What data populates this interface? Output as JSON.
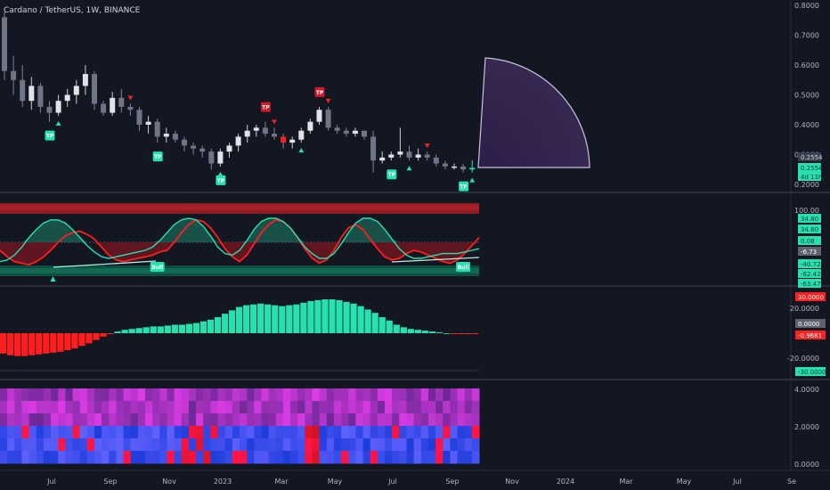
{
  "header": {
    "symbol": "Cardano / TetherUS, 1W, BINANCE"
  },
  "colors": {
    "background": "#131722",
    "bull": "#26e0b0",
    "bear": "#ff1e1e",
    "candle": "#b2b5be",
    "divider": "#2a2e39",
    "fan_fill": "#3a2a55",
    "fan_stroke": "#c8c3de"
  },
  "price_axis": {
    "ticks": [
      "0.8000",
      "0.7000",
      "0.6000",
      "0.5000",
      "0.4000",
      "0.3000",
      "0.2000"
    ],
    "tick_values": [
      0.8,
      0.7,
      0.6,
      0.5,
      0.4,
      0.3,
      0.2
    ],
    "badges": [
      {
        "text": "0.2554",
        "color": "#3a4150"
      },
      {
        "text": "0.2554",
        "color": "#26e0b0"
      },
      {
        "text": "4d 11h",
        "color": "#26e0b0"
      }
    ]
  },
  "osc_axis": {
    "ticks": [
      "100.00"
    ],
    "badges": [
      {
        "text": "34.80",
        "color": "#26e0b0"
      },
      {
        "text": "34.80",
        "color": "#26e0b0"
      },
      {
        "text": "0.08",
        "color": "#26e0b0"
      },
      {
        "text": "-6.73",
        "color": "#5d6270"
      },
      {
        "text": "-40.72",
        "color": "#26e0b0"
      },
      {
        "text": "-62.42",
        "color": "#26e0b0"
      },
      {
        "text": "-63.47",
        "color": "#26e0b0"
      }
    ]
  },
  "hist_axis": {
    "ticks": [
      "20.0000",
      "-20.0000"
    ],
    "badges": [
      {
        "text": "30.0000",
        "color": "#ff1e1e"
      },
      {
        "text": "0.0000",
        "color": "#5d6270"
      },
      {
        "text": "-0.9681",
        "color": "#ff1e1e"
      },
      {
        "text": "-30.0000",
        "color": "#26e0b0"
      }
    ]
  },
  "heat_axis": {
    "ticks": [
      "4.0000",
      "2.0000",
      "0.0000"
    ]
  },
  "time_axis": {
    "labels": [
      "Jul",
      "Sep",
      "Nov",
      "2023",
      "Mar",
      "May",
      "Jul",
      "Sep",
      "Nov",
      "2024",
      "Mar",
      "May",
      "Jul",
      "Se"
    ]
  },
  "markers": {
    "tp": "TP",
    "bull": "Bull",
    "tp_bull_bars": [
      5,
      17,
      24,
      43,
      51
    ],
    "tp_bear_bars": [
      29,
      35
    ],
    "arrow_up_bars": [
      6,
      24,
      33,
      45,
      52
    ],
    "arrow_down_bars": [
      14,
      30,
      36,
      47
    ],
    "bull_labels_bars": [
      17,
      51
    ],
    "osc_arrow_up_bars": [
      5
    ]
  },
  "chart_data": {
    "type": "candlestick",
    "title": "Cardano / TetherUS, 1W, BINANCE",
    "ylim": [
      0.2,
      0.8
    ],
    "candles": [
      [
        0.76,
        0.78,
        0.55,
        0.58
      ],
      [
        0.58,
        0.63,
        0.5,
        0.55
      ],
      [
        0.55,
        0.6,
        0.46,
        0.48
      ],
      [
        0.48,
        0.56,
        0.45,
        0.53
      ],
      [
        0.53,
        0.54,
        0.44,
        0.46
      ],
      [
        0.46,
        0.48,
        0.41,
        0.44
      ],
      [
        0.44,
        0.5,
        0.43,
        0.48
      ],
      [
        0.48,
        0.52,
        0.46,
        0.5
      ],
      [
        0.5,
        0.55,
        0.47,
        0.53
      ],
      [
        0.53,
        0.6,
        0.5,
        0.57
      ],
      [
        0.57,
        0.58,
        0.45,
        0.47
      ],
      [
        0.47,
        0.48,
        0.43,
        0.44
      ],
      [
        0.44,
        0.51,
        0.43,
        0.49
      ],
      [
        0.49,
        0.52,
        0.44,
        0.46
      ],
      [
        0.46,
        0.47,
        0.43,
        0.45
      ],
      [
        0.45,
        0.46,
        0.38,
        0.4
      ],
      [
        0.4,
        0.43,
        0.37,
        0.41
      ],
      [
        0.41,
        0.42,
        0.34,
        0.36
      ],
      [
        0.36,
        0.39,
        0.34,
        0.37
      ],
      [
        0.37,
        0.38,
        0.34,
        0.35
      ],
      [
        0.35,
        0.36,
        0.31,
        0.33
      ],
      [
        0.33,
        0.34,
        0.3,
        0.32
      ],
      [
        0.32,
        0.33,
        0.29,
        0.31
      ],
      [
        0.31,
        0.32,
        0.25,
        0.27
      ],
      [
        0.27,
        0.32,
        0.26,
        0.31
      ],
      [
        0.31,
        0.34,
        0.29,
        0.33
      ],
      [
        0.33,
        0.37,
        0.31,
        0.36
      ],
      [
        0.36,
        0.4,
        0.34,
        0.38
      ],
      [
        0.38,
        0.4,
        0.36,
        0.39
      ],
      [
        0.39,
        0.41,
        0.36,
        0.37
      ],
      [
        0.37,
        0.39,
        0.35,
        0.36
      ],
      [
        0.36,
        0.37,
        0.32,
        0.34
      ],
      [
        0.34,
        0.36,
        0.32,
        0.35
      ],
      [
        0.35,
        0.39,
        0.34,
        0.38
      ],
      [
        0.38,
        0.42,
        0.37,
        0.41
      ],
      [
        0.41,
        0.46,
        0.4,
        0.45
      ],
      [
        0.45,
        0.46,
        0.38,
        0.39
      ],
      [
        0.39,
        0.4,
        0.37,
        0.38
      ],
      [
        0.38,
        0.39,
        0.36,
        0.37
      ],
      [
        0.37,
        0.39,
        0.36,
        0.38
      ],
      [
        0.38,
        0.38,
        0.35,
        0.36
      ],
      [
        0.36,
        0.38,
        0.24,
        0.28
      ],
      [
        0.28,
        0.31,
        0.27,
        0.29
      ],
      [
        0.29,
        0.31,
        0.28,
        0.3
      ],
      [
        0.3,
        0.39,
        0.29,
        0.31
      ],
      [
        0.31,
        0.33,
        0.28,
        0.29
      ],
      [
        0.29,
        0.32,
        0.28,
        0.3
      ],
      [
        0.3,
        0.31,
        0.28,
        0.29
      ],
      [
        0.29,
        0.3,
        0.26,
        0.27
      ],
      [
        0.27,
        0.28,
        0.25,
        0.26
      ],
      [
        0.26,
        0.27,
        0.25,
        0.26
      ],
      [
        0.26,
        0.27,
        0.24,
        0.25
      ],
      [
        0.25,
        0.28,
        0.24,
        0.2554
      ]
    ],
    "histogram": [
      -24,
      -26,
      -27,
      -27,
      -26,
      -25,
      -24,
      -23,
      -22,
      -20,
      -18,
      -15,
      -12,
      -8,
      -4,
      -1,
      2,
      4,
      5,
      6,
      7,
      8,
      8,
      9,
      10,
      10,
      11,
      12,
      14,
      16,
      19,
      23,
      27,
      31,
      33,
      34,
      35,
      34,
      33,
      32,
      33,
      34,
      36,
      38,
      39,
      40,
      40,
      39,
      37,
      35,
      32,
      28,
      24,
      19,
      15,
      10,
      7,
      5,
      4,
      3,
      2,
      1,
      0,
      -1,
      -1,
      -1,
      -1
    ],
    "oscillator": {
      "red": [
        -10,
        -18,
        -24,
        -26,
        -28,
        -24,
        -18,
        -10,
        0,
        8,
        12,
        14,
        10,
        4,
        -6,
        -16,
        -22,
        -24,
        -22,
        -20,
        -18,
        -16,
        -12,
        -10,
        0,
        12,
        22,
        28,
        26,
        18,
        6,
        -8,
        -18,
        -24,
        -16,
        -2,
        12,
        22,
        28,
        26,
        18,
        6,
        -8,
        -20,
        -26,
        -22,
        -10,
        6,
        18,
        22,
        16,
        4,
        -8,
        -18,
        -22,
        -20,
        -14,
        -10,
        -12,
        -16,
        -20,
        -24,
        -26,
        -22,
        -14,
        -4,
        6
      ],
      "teal": [
        -24,
        -22,
        -16,
        -6,
        6,
        16,
        24,
        28,
        28,
        24,
        16,
        6,
        -4,
        -12,
        -18,
        -20,
        -18,
        -16,
        -14,
        -12,
        -10,
        -6,
        2,
        12,
        22,
        28,
        30,
        28,
        20,
        8,
        -6,
        -14,
        -16,
        -10,
        2,
        16,
        26,
        30,
        30,
        26,
        18,
        6,
        -6,
        -14,
        -20,
        -20,
        -14,
        -2,
        12,
        24,
        30,
        30,
        26,
        16,
        4,
        -8,
        -16,
        -20,
        -20,
        -18,
        -16,
        -14,
        -14,
        -14,
        -12,
        -10,
        -8
      ]
    },
    "heatmap": {
      "rows": 6,
      "cols": 66,
      "ylim": [
        0,
        4
      ]
    }
  }
}
